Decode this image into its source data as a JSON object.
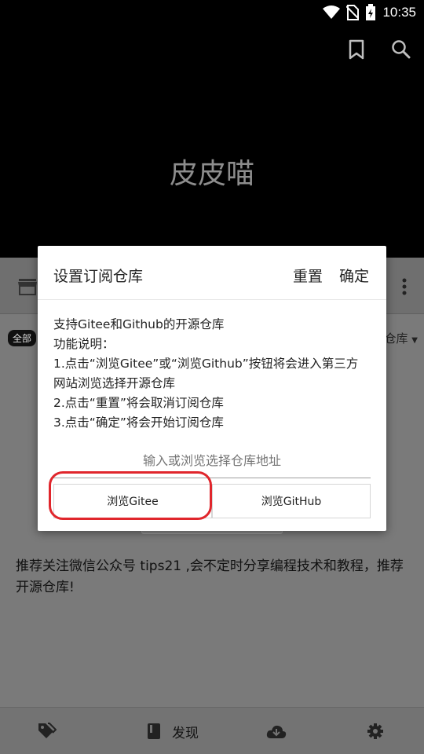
{
  "status_bar": {
    "time": "10:35"
  },
  "header": {
    "app_title": "皮皮喵"
  },
  "page": {
    "chip_left": "全部",
    "chip_right": "仓库",
    "recommend_text": "推荐关注微信公众号 tips21 ,会不定时分享编程技术和教程，推荐开源仓库!"
  },
  "bottom_nav": {
    "discover_label": "发现"
  },
  "dialog": {
    "title": "设置订阅仓库",
    "reset_label": "重置",
    "confirm_label": "确定",
    "description_lines": [
      "支持Gitee和Github的开源仓库",
      "功能说明：",
      "1.点击“浏览Gitee”或“浏览Github”按钮将会进入第三方",
      "网站浏览选择开源仓库",
      "2.点击“重置”将会取消订阅仓库",
      "3.点击“确定”将会开始订阅仓库"
    ],
    "input_placeholder": "输入或浏览选择仓库地址",
    "input_value": "",
    "browse_gitee_label": "浏览Gitee",
    "browse_github_label": "浏览GitHub"
  },
  "colors": {
    "annotation_red": "#e0262c"
  }
}
